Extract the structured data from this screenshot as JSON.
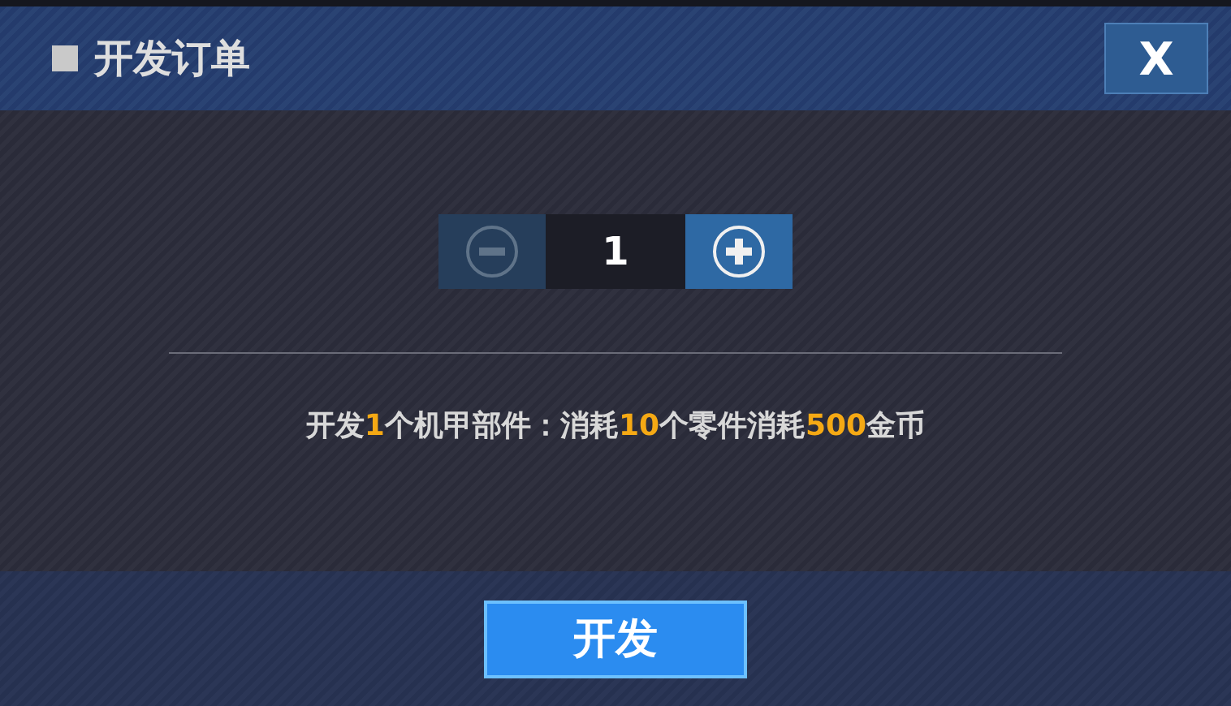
{
  "dialog": {
    "title": "开发订单",
    "close": "X"
  },
  "stepper": {
    "value": "1",
    "minus_disabled": true,
    "plus_disabled": false
  },
  "message": [
    {
      "text": "开发",
      "highlight": false
    },
    {
      "text": "1",
      "highlight": true
    },
    {
      "text": "个机甲部件：消耗",
      "highlight": false
    },
    {
      "text": "10",
      "highlight": true
    },
    {
      "text": "个零件消耗",
      "highlight": false
    },
    {
      "text": "500",
      "highlight": true
    },
    {
      "text": "金币",
      "highlight": false
    }
  ],
  "confirm_button": "开发"
}
